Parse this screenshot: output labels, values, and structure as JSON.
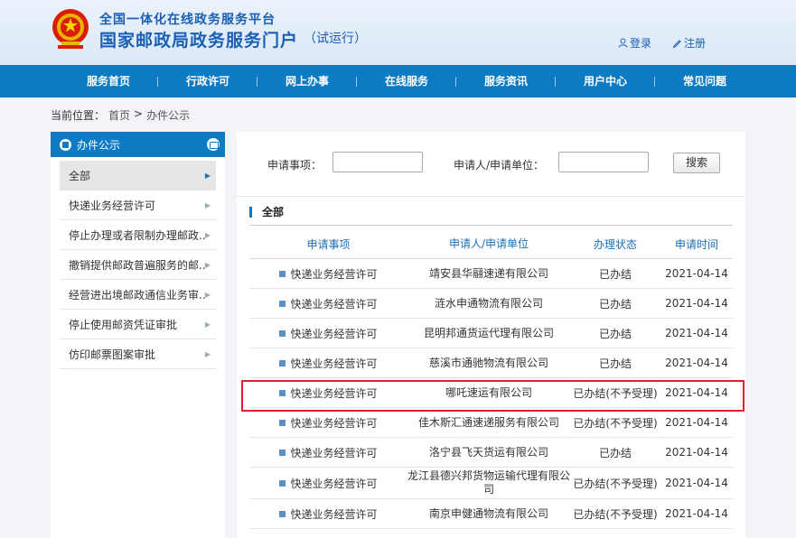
{
  "header": {
    "platform_name": "全国一体化在线政务服务平台",
    "portal_name": "国家邮政局政务服务门户",
    "trial_note": "（试运行）",
    "login_label": "登录",
    "register_label": "注册"
  },
  "nav": [
    {
      "label": "服务首页"
    },
    {
      "label": "行政许可"
    },
    {
      "label": "网上办事"
    },
    {
      "label": "在线服务"
    },
    {
      "label": "服务资讯"
    },
    {
      "label": "用户中心"
    },
    {
      "label": "常见问题"
    }
  ],
  "breadcrumb": {
    "prefix": "当前位置：",
    "home": "首页",
    "separator": ">",
    "current": "办件公示"
  },
  "sidebar": {
    "title": "办件公示",
    "items": [
      {
        "label": "全部",
        "active": true
      },
      {
        "label": "快递业务经营许可"
      },
      {
        "label": "停止办理或者限制办理邮政..."
      },
      {
        "label": "撤销提供邮政普遍服务的邮..."
      },
      {
        "label": "经营进出境邮政通信业务审..."
      },
      {
        "label": "停止使用邮资凭证审批"
      },
      {
        "label": "仿印邮票图案审批"
      }
    ]
  },
  "search": {
    "item_label": "申请事项：",
    "item_value": "",
    "applicant_label": "申请人/申请单位：",
    "applicant_value": "",
    "button_label": "搜索"
  },
  "section_title": "全部",
  "table": {
    "headers": [
      "申请事项",
      "申请人/申请单位",
      "办理状态",
      "申请时间"
    ],
    "rows": [
      {
        "item": "快递业务经营许可",
        "applicant": "靖安县华翮速递有限公司",
        "status": "已办结",
        "date": "2021-04-14"
      },
      {
        "item": "快递业务经营许可",
        "applicant": "涟水申通物流有限公司",
        "status": "已办结",
        "date": "2021-04-14"
      },
      {
        "item": "快递业务经营许可",
        "applicant": "昆明邦通货运代理有限公司",
        "status": "已办结",
        "date": "2021-04-14"
      },
      {
        "item": "快递业务经营许可",
        "applicant": "慈溪市通驰物流有限公司",
        "status": "已办结",
        "date": "2021-04-14"
      },
      {
        "item": "快递业务经营许可",
        "applicant": "哪吒速运有限公司",
        "status": "已办结(不予受理)",
        "date": "2021-04-14",
        "highlighted": true
      },
      {
        "item": "快递业务经营许可",
        "applicant": "佳木斯汇通速递服务有限公司",
        "status": "已办结(不予受理)",
        "date": "2021-04-14"
      },
      {
        "item": "快递业务经营许可",
        "applicant": "洛宁县飞天货运有限公司",
        "status": "已办结",
        "date": "2021-04-14"
      },
      {
        "item": "快递业务经营许可",
        "applicant": "龙江县德兴邦货物运输代理有限公司",
        "status": "已办结(不予受理)",
        "date": "2021-04-14"
      },
      {
        "item": "快递业务经营许可",
        "applicant": "南京申健通物流有限公司",
        "status": "已办结(不予受理)",
        "date": "2021-04-14"
      }
    ]
  },
  "colors": {
    "nav_bg": "#0d7ac4",
    "brand_text": "#1a5fb4",
    "highlight_border": "#e0202e"
  }
}
